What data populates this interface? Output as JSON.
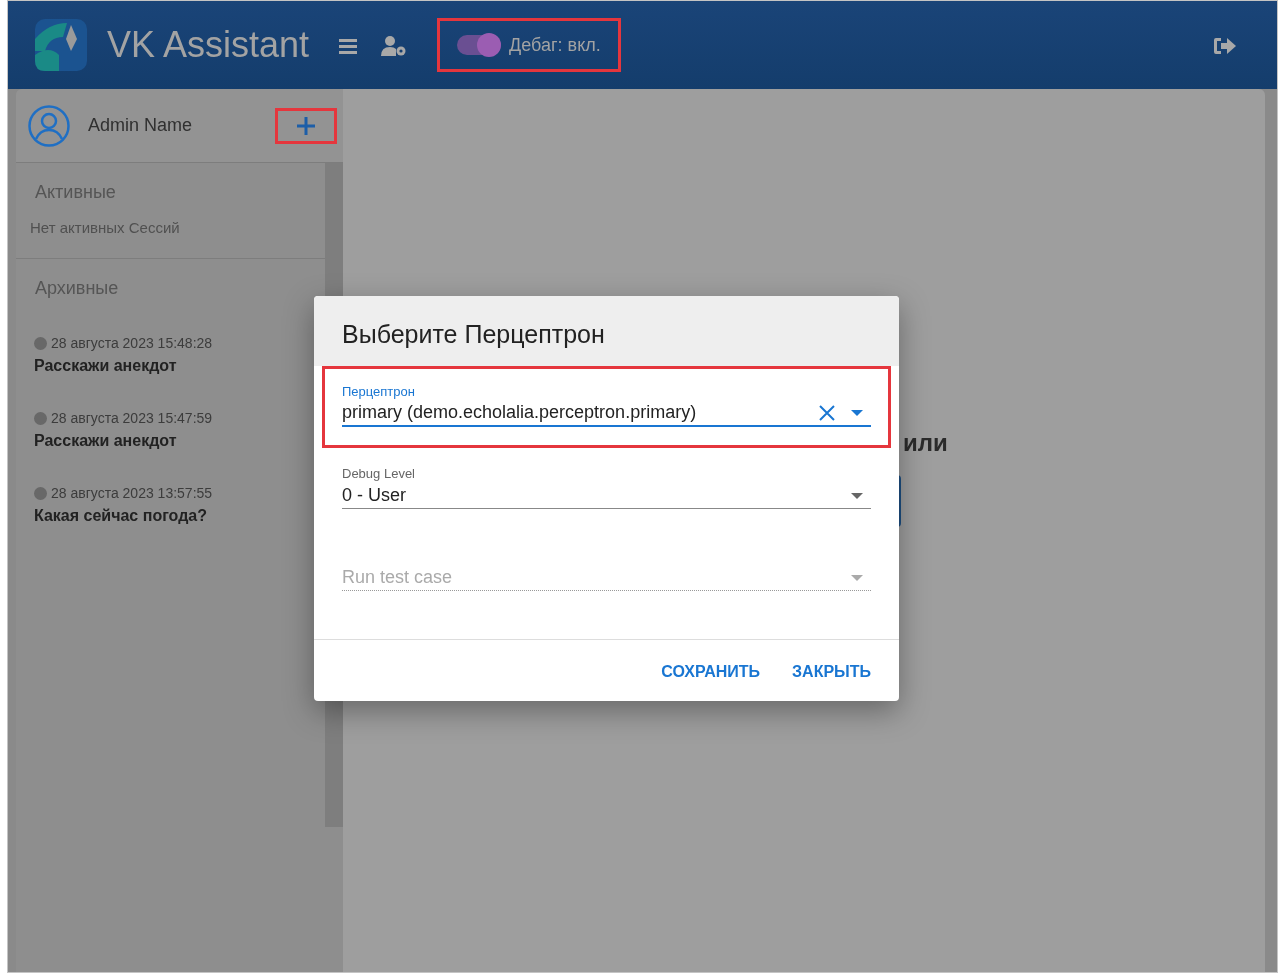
{
  "header": {
    "title": "VK Assistant",
    "debug_toggle": {
      "label": "Дебаг: вкл.",
      "on": true,
      "highlighted": true
    }
  },
  "sidebar": {
    "user": {
      "name": "Admin Name",
      "add_highlighted": true
    },
    "active": {
      "title": "Активные",
      "empty_text": "Нет активных Сессий"
    },
    "archive": {
      "title": "Архивные",
      "sessions": [
        {
          "time": "28 августа 2023 15:48:28",
          "title": "Расскажи анекдот"
        },
        {
          "time": "28 августа 2023 15:47:59",
          "title": "Расскажи анекдот"
        },
        {
          "time": "28 августа 2023 13:57:55",
          "title": "Какая сейчас погода?"
        }
      ]
    }
  },
  "main": {
    "background_text": "или"
  },
  "dialog": {
    "title": "Выберите Перцептрон",
    "fields": [
      {
        "label": "Перцептрон",
        "value": "primary (demo.echolalia.perceptron.primary)",
        "focused": true,
        "clearable": true,
        "disabled": false,
        "highlighted": true
      },
      {
        "label": "Debug Level",
        "value": "0 - User",
        "focused": false,
        "clearable": false,
        "disabled": false,
        "highlighted": false
      },
      {
        "placeholder": "Run test case",
        "focused": false,
        "clearable": false,
        "disabled": true,
        "highlighted": false
      }
    ],
    "actions": [
      "СОХРАНИТЬ",
      "ЗАКРЫТЬ"
    ]
  }
}
